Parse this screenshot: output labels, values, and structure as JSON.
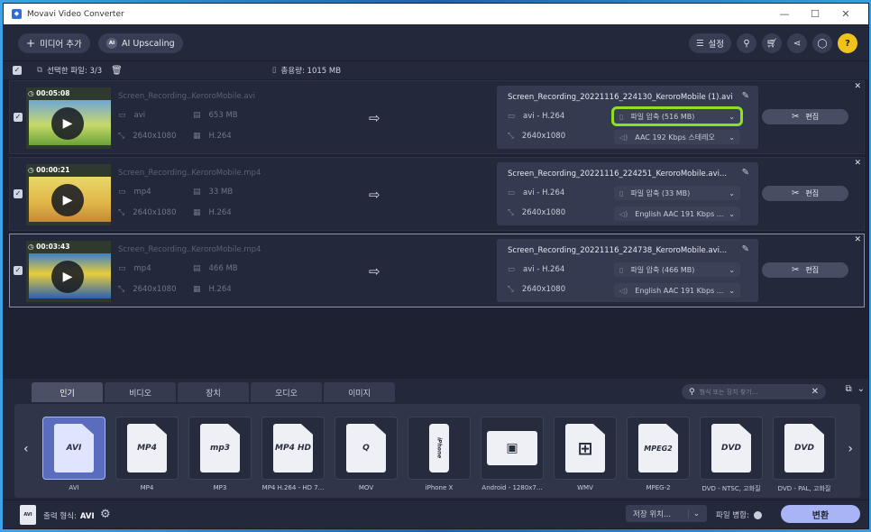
{
  "window": {
    "title": "Movavi Video Converter",
    "minimize": "—",
    "maximize": "☐",
    "close": "✕"
  },
  "toolbar": {
    "add_media": "미디어 추가",
    "ai_upscaling": "AI Upscaling",
    "ai_badge": "AI",
    "settings": "설정"
  },
  "selection": {
    "selected_label": "선택한 파일: 3/3",
    "total_size": "총용량: 1015 MB"
  },
  "files": [
    {
      "duration": "00:05:08",
      "source_name": "Screen_Recording..KeroroMobile.avi",
      "container": "avi",
      "size": "653 MB",
      "resolution": "2640x1080",
      "codec": "H.264",
      "output_name": "Screen_Recording_20221116_224130_KeroroMobile (1).avi",
      "output_format": "avi - H.264",
      "output_resolution": "2640x1080",
      "compression": "파일 압축 (516 MB)",
      "audio": "AAC 192 Kbps 스테레오",
      "edit": "편집"
    },
    {
      "duration": "00:00:21",
      "source_name": "Screen_Recording..KeroroMobile.mp4",
      "container": "mp4",
      "size": "33 MB",
      "resolution": "2640x1080",
      "codec": "H.264",
      "output_name": "Screen_Recording_20221116_224251_KeroroMobile.avi...",
      "output_format": "avi - H.264",
      "output_resolution": "2640x1080",
      "compression": "파일 압축 (33 MB)",
      "audio": "English AAC 191 Kbps ...",
      "edit": "편집"
    },
    {
      "duration": "00:03:43",
      "source_name": "Screen_Recording..KeroroMobile.mp4",
      "container": "mp4",
      "size": "466 MB",
      "resolution": "2640x1080",
      "codec": "H.264",
      "output_name": "Screen_Recording_20221116_224738_KeroroMobile.avi...",
      "output_format": "avi - H.264",
      "output_resolution": "2640x1080",
      "compression": "파일 압축 (466 MB)",
      "audio": "English AAC 191 Kbps ...",
      "edit": "편집"
    }
  ],
  "tabs": [
    "인기",
    "비디오",
    "장치",
    "오디오",
    "이미지"
  ],
  "search": {
    "placeholder": "형식 또는 장치 찾기..."
  },
  "formats": [
    {
      "icon_text": "AVI",
      "label": "AVI"
    },
    {
      "icon_text": "MP4",
      "label": "MP4"
    },
    {
      "icon_text": "mp3",
      "label": "MP3"
    },
    {
      "icon_text": "MP4 HD",
      "label": "MP4 H.264 - HD 7..."
    },
    {
      "icon_text": "Q",
      "label": "MOV"
    },
    {
      "icon_text": "iPhone",
      "label": "iPhone X"
    },
    {
      "icon_text": "▣",
      "label": "Android - 1280x7..."
    },
    {
      "icon_text": "⊞",
      "label": "WMV"
    },
    {
      "icon_text": "MPEG2",
      "label": "MPEG-2"
    },
    {
      "icon_text": "DVD",
      "label": "DVD - NTSC, 고화질"
    },
    {
      "icon_text": "DVD",
      "label": "DVD - PAL, 고화질"
    }
  ],
  "bottom": {
    "output_format_label": "출력 형식:",
    "output_format_value": "AVI",
    "save_location": "저장 위치...",
    "merge_files": "파일 병합:",
    "convert": "변환"
  },
  "colors": {
    "highlight": "#8ee021",
    "accent": "#a9b4f7",
    "help": "#f1c21b"
  }
}
